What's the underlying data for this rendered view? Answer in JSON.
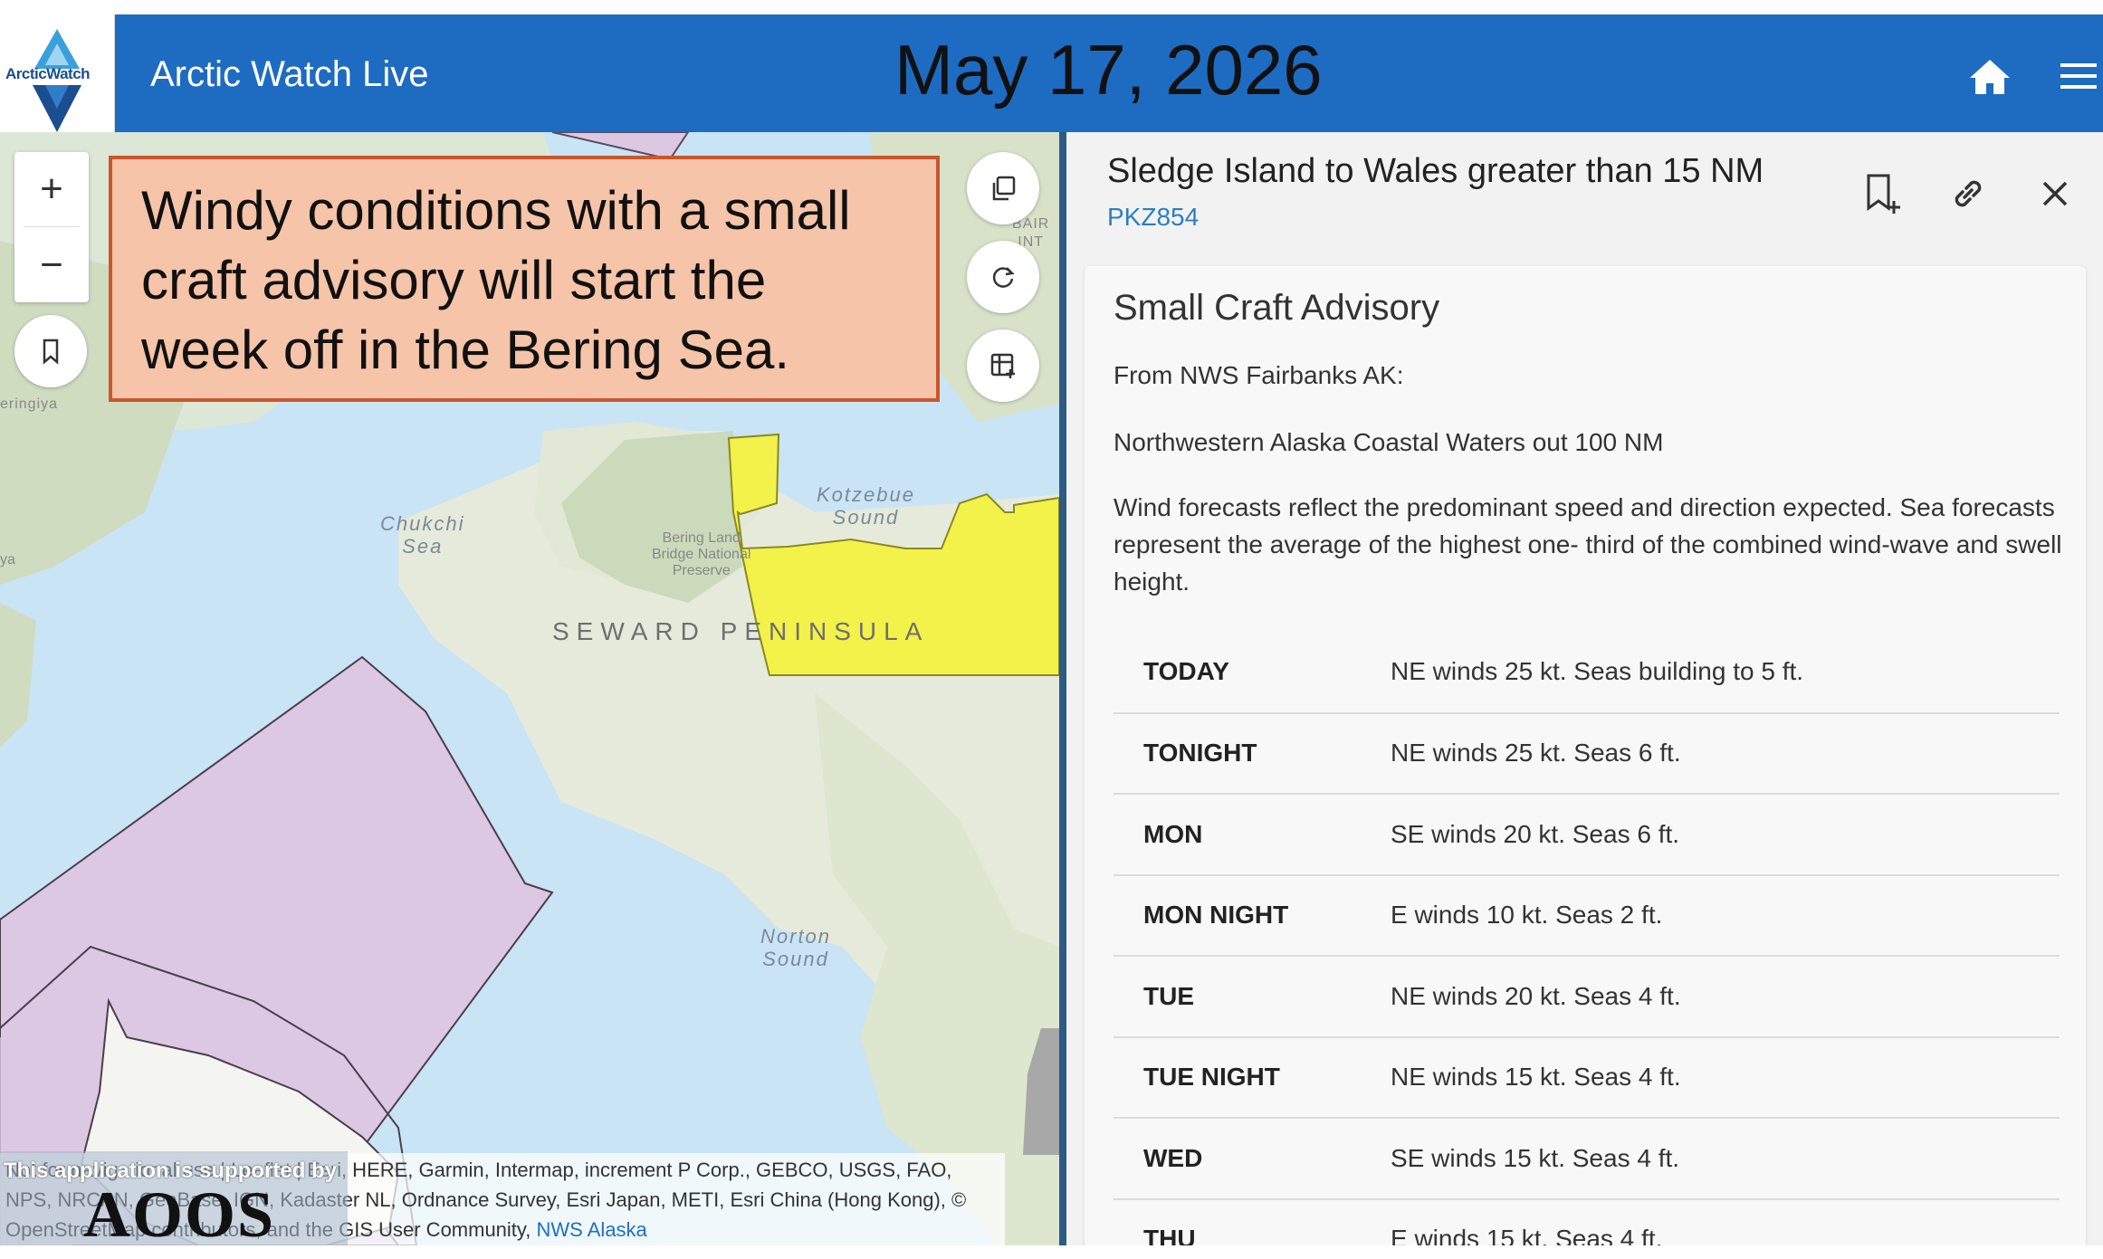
{
  "header": {
    "logo_text": "ArcticWatch",
    "app_title": "Arctic Watch Live",
    "date": "May 17, 2026",
    "icons": [
      "home-icon",
      "menu-icon"
    ]
  },
  "map": {
    "callout": "Windy conditions with a small craft advisory will start the week off in the Bering Sea.",
    "labels": {
      "chukchi": "Chukchi\nSea",
      "kotzebue": "Kotzebue\nSound",
      "seward": "SEWARD PENINSULA",
      "norton": "Norton\nSound",
      "bering_preserve": "Bering Land\nBridge National\nPreserve",
      "beringiya": "eringiya",
      "bair": "BAIR\nINT",
      "ya": "ya"
    },
    "zoom_in": "+",
    "zoom_out": "−",
    "attribution_text": "Not for navigational use | Leaflet | Esri, HERE, Garmin, Intermap, increment P Corp., GEBCO, USGS, FAO, NPS, NRCAN, GeoBase, IGN, Kadaster NL, Ordnance Survey, Esri Japan, METI, Esri China (Hong Kong), © OpenStreetMap contributors, and the GIS User Community,",
    "attribution_link": "NWS Alaska",
    "supported_by": "This application is supported by",
    "aoos": "AOOS",
    "advisory_color": "#f2f24a",
    "zone_color": "#dcc8e2"
  },
  "panel": {
    "title": "Sledge Island to Wales greater than 15 NM",
    "zone_id": "PKZ854",
    "card_title": "Small Craft Advisory",
    "from": "From NWS Fairbanks AK:",
    "area": "Northwestern Alaska Coastal Waters out 100 NM",
    "note": "Wind forecasts reflect the predominant speed and direction expected. Sea forecasts represent the average of the highest one- third of the combined wind-wave and swell height.",
    "forecast": [
      {
        "period": "TODAY",
        "text": "NE winds 25 kt. Seas building to 5 ft."
      },
      {
        "period": "TONIGHT",
        "text": "NE winds 25 kt. Seas 6 ft."
      },
      {
        "period": "MON",
        "text": "SE winds 20 kt. Seas 6 ft."
      },
      {
        "period": "MON NIGHT",
        "text": "E winds 10 kt. Seas 2 ft."
      },
      {
        "period": "TUE",
        "text": "NE winds 20 kt. Seas 4 ft."
      },
      {
        "period": "TUE NIGHT",
        "text": "NE winds 15 kt. Seas 4 ft."
      },
      {
        "period": "WED",
        "text": "SE winds 15 kt. Seas 4 ft."
      },
      {
        "period": "THU",
        "text": "E winds 15 kt. Seas 4 ft."
      }
    ]
  }
}
